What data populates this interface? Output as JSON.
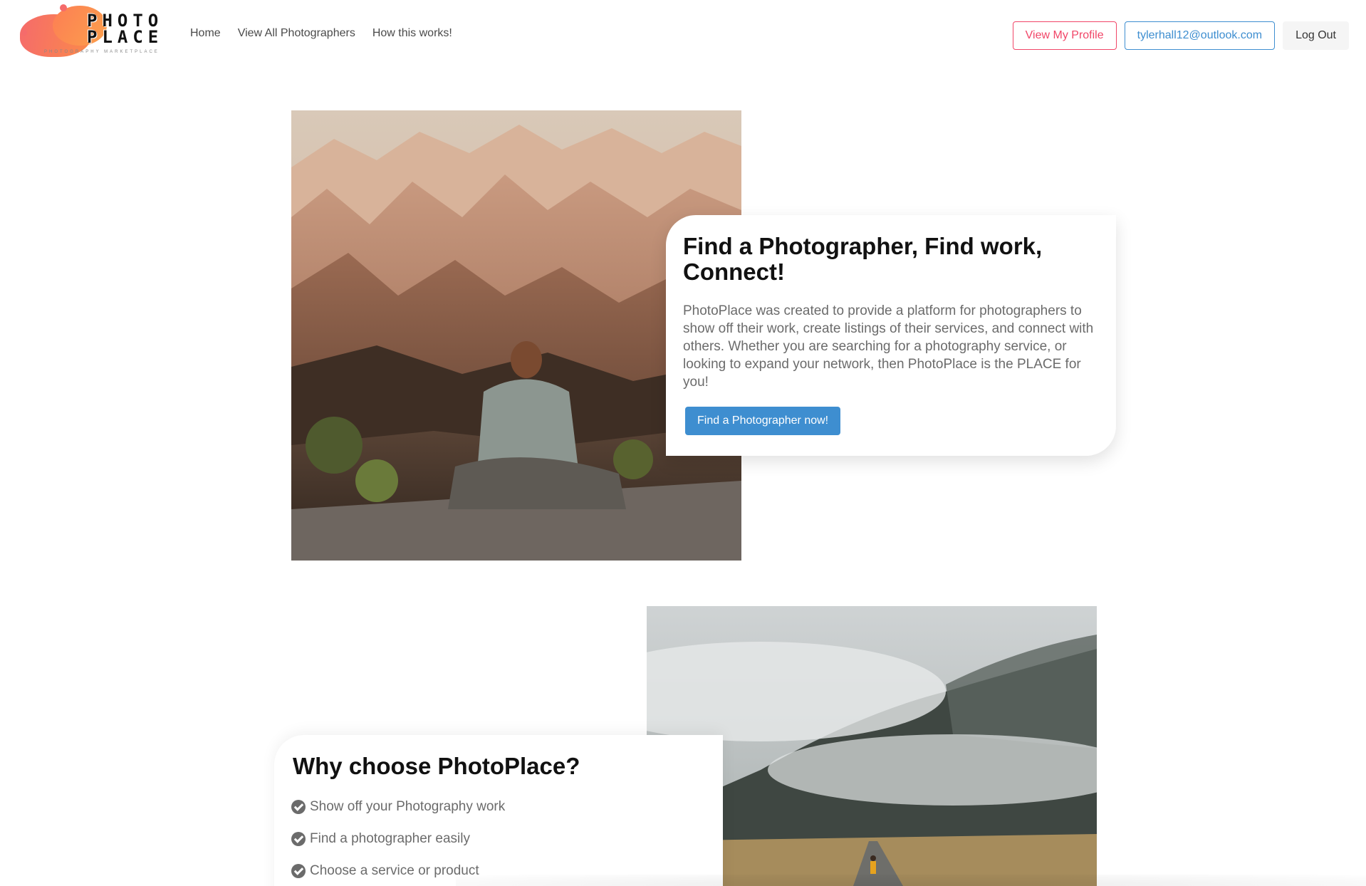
{
  "logo": {
    "wordmark_line1": "PHOTO",
    "wordmark_line2": "PLACE",
    "tagline": "PHOTOGRAPHY MARKETPLACE"
  },
  "nav": {
    "links": [
      "Home",
      "View All Photographers",
      "How this works!"
    ],
    "profile_button": "View My Profile",
    "email_button": "tylerhall12@outlook.com",
    "logout_button": "Log Out"
  },
  "hero": {
    "title": "Find a Photographer, Find work, Connect!",
    "description": "PhotoPlace was created to provide a platform for photographers to show off their work, create listings of their services, and connect with others. Whether you are searching for a photography service, or looking to expand your network, then PhotoPlace is the PLACE for you!",
    "cta": "Find a Photographer now!",
    "image_subject": "person sitting on canyon edge"
  },
  "why": {
    "title": "Why choose PhotoPlace?",
    "items": [
      "Show off your Photography work",
      "Find a photographer easily",
      "Choose a service or product"
    ],
    "image_subject": "person walking on road in misty mountains"
  },
  "colors": {
    "danger": "#f14668",
    "info": "#3e8ed0",
    "light": "#f5f5f5",
    "brand_orange": "#fb8a4a"
  }
}
